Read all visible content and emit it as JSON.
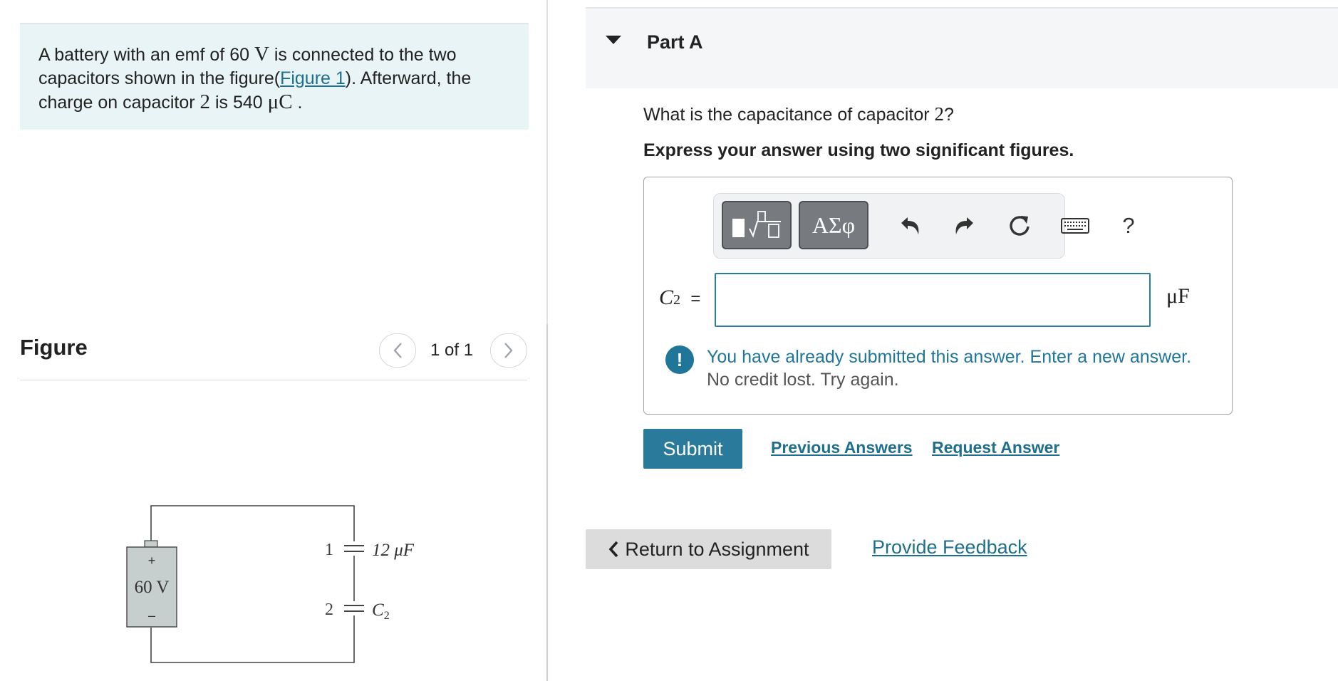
{
  "problem": {
    "text_1": "A battery with an emf of 60 ",
    "emf_unit": "V",
    "text_2": " is connected to the two capacitors shown in the figure(",
    "figure_link": "Figure 1",
    "text_3": "). Afterward, the charge on capacitor ",
    "cap_number": "2",
    "text_4": " is 540 ",
    "charge_unit": "μC",
    "text_5": " ."
  },
  "figure": {
    "title": "Figure",
    "counter": "1 of 1",
    "prev_icon": "chevron-left-icon",
    "next_icon": "chevron-right-icon",
    "circuit": {
      "battery_label": "60 V",
      "plus": "+",
      "minus": "–",
      "cap1_number": "1",
      "cap1_value": "12 μF",
      "cap2_number": "2",
      "cap2_label": "C",
      "cap2_sub": "2"
    }
  },
  "part": {
    "title": "Part A",
    "question_prefix": "What is the capacitance of capacitor ",
    "question_number": "2",
    "question_suffix": "?",
    "instruction": "Express your answer using two significant figures."
  },
  "toolbar": {
    "greek_label": "ΑΣφ",
    "help_label": "?",
    "icons": [
      "templates-icon",
      "greek-symbols-icon",
      "undo-icon",
      "redo-icon",
      "reset-icon",
      "keyboard-icon",
      "help-icon"
    ]
  },
  "answer": {
    "var": "C",
    "var_sub": "2",
    "equals": "=",
    "value": "",
    "unit": "μF"
  },
  "alert": {
    "message": "You have already submitted this answer. Enter a new answer.",
    "detail": "No credit lost. Try again."
  },
  "actions": {
    "submit": "Submit",
    "previous_answers": "Previous Answers",
    "request_answer": "Request Answer",
    "return": "Return to Assignment",
    "feedback": "Provide Feedback"
  },
  "colors": {
    "accent": "#2a7b9b",
    "link": "#1f6f8b",
    "problem_bg": "#e8f4f6",
    "battery_fill": "#c6cfce"
  }
}
